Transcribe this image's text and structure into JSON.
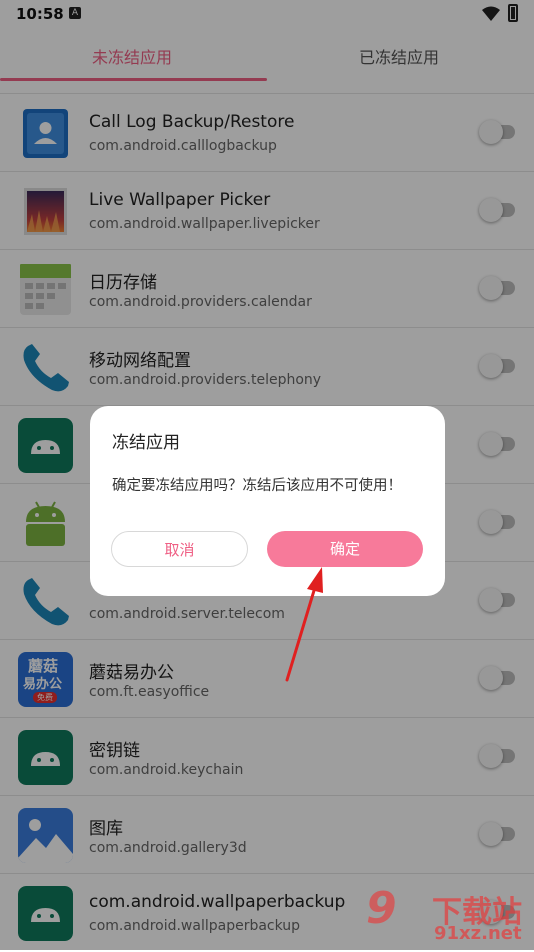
{
  "status": {
    "time": "10:58",
    "notif": "A"
  },
  "tabs": [
    {
      "label": "未冻结应用",
      "active": true
    },
    {
      "label": "已冻结应用",
      "active": false
    }
  ],
  "apps": [
    {
      "name": "Call Log Backup/Restore",
      "package": "com.android.calllogbackup",
      "icon": "contacts-card-icon",
      "enabled": false
    },
    {
      "name": "Live Wallpaper Picker",
      "package": "com.android.wallpaper.livepicker",
      "icon": "wallpaper-picture-icon",
      "enabled": false
    },
    {
      "name": "日历存储",
      "package": "com.android.providers.calendar",
      "icon": "calendar-icon",
      "enabled": false
    },
    {
      "name": "移动网络配置",
      "package": "com.android.providers.telephony",
      "icon": "phone-handset-icon",
      "enabled": false
    },
    {
      "name": "",
      "package": "",
      "icon": "android-robot-icon",
      "enabled": false
    },
    {
      "name": "",
      "package": "",
      "icon": "android-robot-icon",
      "enabled": false
    },
    {
      "name": "",
      "package": "com.android.server.telecom",
      "icon": "phone-handset-icon",
      "enabled": false
    },
    {
      "name": "蘑菇易办公",
      "package": "com.ft.easyoffice",
      "icon": "mogu-office-logo-icon",
      "enabled": false
    },
    {
      "name": "密钥链",
      "package": "com.android.keychain",
      "icon": "android-robot-icon",
      "enabled": false
    },
    {
      "name": "图库",
      "package": "com.android.gallery3d",
      "icon": "gallery-mountain-icon",
      "enabled": false
    },
    {
      "name": "com.android.wallpaperbackup",
      "package": "com.android.wallpaperbackup",
      "icon": "android-robot-icon",
      "enabled": false
    }
  ],
  "dialog": {
    "title": "冻结应用",
    "message": "确定要冻结应用吗？冻结后该应用不可使用！",
    "cancel_label": "取消",
    "confirm_label": "确定"
  },
  "logo_texts": {
    "mogu_top": "蘑菇",
    "mogu_mid": "易办公",
    "mogu_badge": "免费"
  },
  "watermark": {
    "mark": "9",
    "cn": "下载站",
    "url": "91xz.net"
  },
  "colors": {
    "accent": "#ef5f84",
    "confirm": "#f77a9a",
    "arrow": "#e02020"
  }
}
